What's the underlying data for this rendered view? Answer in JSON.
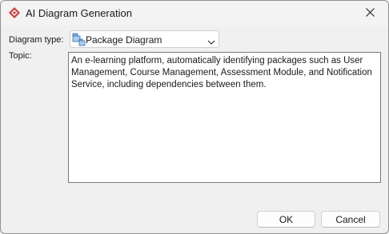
{
  "window": {
    "title": "AI Diagram Generation",
    "app_icon": "diamond-logo-icon",
    "close_icon": "close-icon"
  },
  "form": {
    "diagram_type_label": "Diagram type:",
    "diagram_type_value": "Package Diagram",
    "diagram_type_icon": "package-diagram-icon",
    "topic_label": "Topic:",
    "topic_value": "An e-learning platform, automatically identifying packages such as User Management, Course Management, Assessment Module, and Notification Service, including dependencies between them."
  },
  "buttons": {
    "ok_label": "OK",
    "cancel_label": "Cancel"
  },
  "colors": {
    "accent_red": "#d93a3a",
    "window_bg": "#f0f0f0"
  }
}
